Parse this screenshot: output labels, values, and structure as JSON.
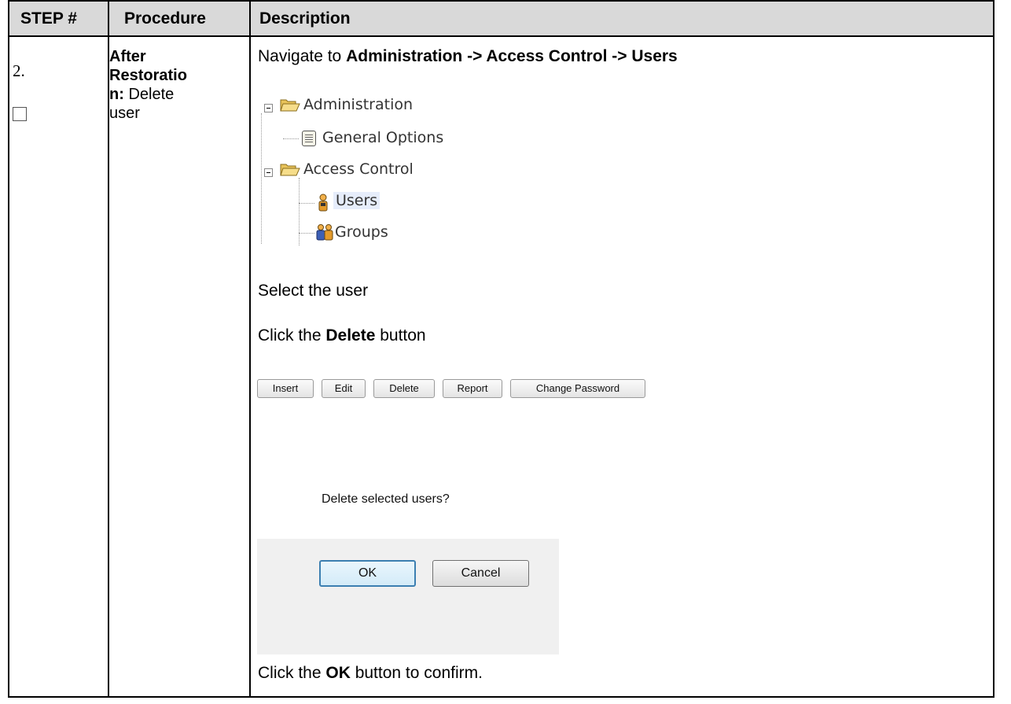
{
  "header": {
    "step": "STEP #",
    "procedure": "Procedure",
    "description": "Description"
  },
  "step": {
    "number": "2.",
    "procedure_bold": "After Restoration:",
    "procedure_line1": "After",
    "procedure_line2": "Restoratio",
    "procedure_line3_bold": "n:",
    "procedure_line3_rest": " Delete",
    "procedure_line4": "user"
  },
  "desc": {
    "nav_prefix": "Navigate to ",
    "nav_path": "Administration -> Access Control -> Users",
    "select_user": "Select the user",
    "click_prefix": "Click the ",
    "click_delete": "Delete",
    "click_suffix": " button",
    "ok_prefix": "Click the ",
    "ok_word": "OK",
    "ok_suffix": " button to confirm."
  },
  "tree": {
    "administration": "Administration",
    "general_options": "General Options",
    "access_control": "Access Control",
    "users": "Users",
    "groups": "Groups"
  },
  "toolbar": {
    "insert": "Insert",
    "edit": "Edit",
    "delete": "Delete",
    "report": "Report",
    "change_password": "Change Password"
  },
  "dialog": {
    "question": "Delete selected users?",
    "ok": "OK",
    "cancel": "Cancel"
  }
}
